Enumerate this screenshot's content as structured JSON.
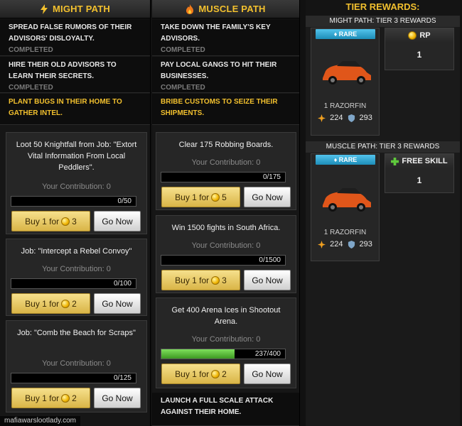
{
  "might_path": {
    "title": "MIGHT PATH",
    "missions": [
      {
        "text": "SPREAD FALSE RUMORS OF THEIR ADVISORS' DISLOYALTY.",
        "status": "COMPLETED"
      },
      {
        "text": "HIRE THEIR OLD ADVISORS TO LEARN THEIR SECRETS.",
        "status": "COMPLETED"
      },
      {
        "text": "PLANT BUGS IN THEIR HOME TO GATHER INTEL.",
        "status": ""
      }
    ],
    "tasks": [
      {
        "title": "Loot 50 Knightfall from Job: \"Extort Vital Information From Local Peddlers\".",
        "contribution": "Your Contribution: 0",
        "progress_text": "0/50",
        "progress": 0.0,
        "buy_label": "Buy 1 for",
        "cost": "3",
        "go_label": "Go Now"
      },
      {
        "title": "Job: \"Intercept a Rebel Convoy\"",
        "contribution": "Your Contribution: 0",
        "progress_text": "0/100",
        "progress": 0.0,
        "buy_label": "Buy 1 for",
        "cost": "2",
        "go_label": "Go Now"
      },
      {
        "title": "Job: \"Comb the Beach for Scraps\"",
        "contribution": "Your Contribution: 0",
        "progress_text": "0/125",
        "progress": 0.0,
        "buy_label": "Buy 1 for",
        "cost": "2",
        "go_label": "Go Now"
      }
    ]
  },
  "muscle_path": {
    "title": "MUSCLE PATH",
    "missions": [
      {
        "text": "TAKE DOWN THE FAMILY'S KEY ADVISORS.",
        "status": "COMPLETED"
      },
      {
        "text": "PAY LOCAL GANGS TO HIT THEIR BUSINESSES.",
        "status": "COMPLETED"
      },
      {
        "text": "BRIBE CUSTOMS TO SEIZE THEIR SHIPMENTS.",
        "status": ""
      },
      {
        "text": "LAUNCH A FULL SCALE ATTACK AGAINST THEIR HOME.",
        "status": ""
      }
    ],
    "tasks": [
      {
        "title": "Clear 175 Robbing Boards.",
        "contribution": "Your Contribution: 0",
        "progress_text": "0/175",
        "progress": 0.0,
        "buy_label": "Buy 1 for",
        "cost": "5",
        "go_label": "Go Now"
      },
      {
        "title": "Win 1500 fights in South Africa.",
        "contribution": "Your Contribution: 0",
        "progress_text": "0/1500",
        "progress": 0.0,
        "buy_label": "Buy 1 for",
        "cost": "3",
        "go_label": "Go Now"
      },
      {
        "title": "Get 400 Arena Ices in Shootout Arena.",
        "contribution": "Your Contribution: 0",
        "progress_text": "237/400",
        "progress": 0.5925,
        "buy_label": "Buy 1 for",
        "cost": "2",
        "go_label": "Go Now"
      }
    ]
  },
  "tier_rewards": {
    "title": "TIER REWARDS:",
    "might": {
      "subtitle": "MIGHT PATH: TIER 3 REWARDS",
      "item": {
        "rarity": "RARE",
        "name": "1 RAZORFIN",
        "attack": "224",
        "defense": "293"
      },
      "bonus": {
        "label": "RP",
        "value": "1",
        "icon": "rp-coin-icon"
      }
    },
    "muscle": {
      "subtitle": "MUSCLE PATH: TIER 3 REWARDS",
      "item": {
        "rarity": "RARE",
        "name": "1 RAZORFIN",
        "attack": "224",
        "defense": "293"
      },
      "bonus": {
        "label": "FREE SKILL",
        "value": "1",
        "icon": "plus-icon"
      }
    }
  },
  "watermark": "mafiawarslootlady.com",
  "colors": {
    "accent": "#f2c02e",
    "rarity": "#2aa6d6",
    "progress": "#5fc93c"
  }
}
